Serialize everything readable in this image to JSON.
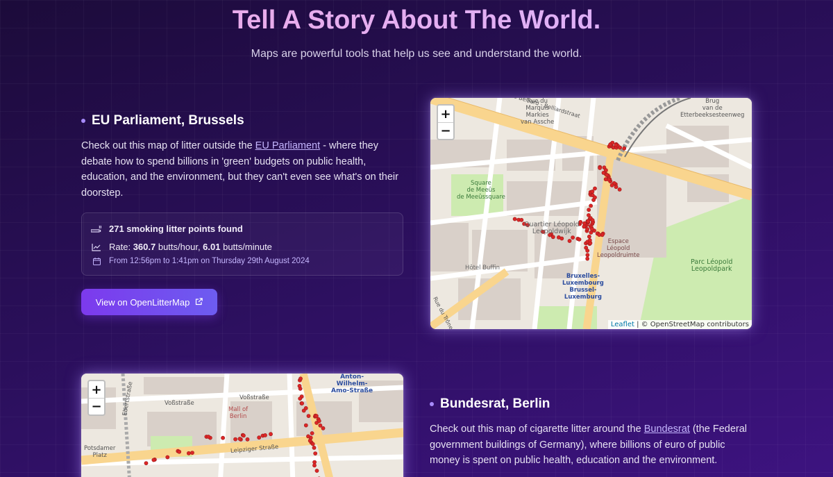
{
  "hero": {
    "title": "Tell A Story About The World.",
    "subtitle": "Maps are powerful tools that help us see and understand the world."
  },
  "sections": [
    {
      "title": "EU Parliament, Brussels",
      "paragraph_before": "Check out this map of litter outside the ",
      "link_text": "EU Parliament",
      "paragraph_after": " - where they debate how to spend billions in 'green' budgets on public health, education, and the environment, but they can't even see what's on their doorstep.",
      "stats": {
        "points": "271 smoking litter points found",
        "rate_prefix": "Rate: ",
        "rate_hour": "360.7",
        "rate_hour_unit": " butts/hour, ",
        "rate_min": "6.01",
        "rate_min_unit": " butts/minute",
        "time_range": "From 12:56pm to 1:41pm on Thursday 29th August 2024"
      },
      "button_label": "View on OpenLitterMap",
      "map": {
        "zoom_in": "+",
        "zoom_out": "−",
        "attribution_leaflet": "Leaflet",
        "attribution_rest": " | © OpenStreetMap contributors",
        "labels": {
          "rue_belliard": "Rue Belliard - Belliardstraat",
          "rue_markies": "Rue du\nMarquis\nMarkies\nvan Assche",
          "brug": "Brug\nvan de\nEtterbeeksesteenweg",
          "square_meeus": "Square\nde Meeûs\nde Meeûssquare",
          "quartier_leopold": "Quartier Léopold\nLeopoldwijk",
          "espace_leopold": "Espace\nLéopold\nLeopoldruimte",
          "parc_leopold": "Parc Léopold\nLeopoldpark",
          "hotel_buffin": "Hôtel Buffin",
          "bruxelles_lux": "Bruxelles-\nLuxembourg\nBrussel-\nLuxemburg",
          "rue_trone": "Rue du Trône - Troonstr"
        }
      }
    },
    {
      "title": "Bundesrat, Berlin",
      "paragraph_before": "Check out this map of cigarette litter around the ",
      "link_text": "Bundesrat",
      "paragraph_after": " (the Federal government buildings of Germany), where billions of euro of public money is spent on public health, education and the environment.",
      "map": {
        "zoom_in": "+",
        "zoom_out": "−",
        "labels": {
          "anton": "Anton-\nWilhelm-\nAmo-Straße",
          "voss": "Voßstraße",
          "voss2": "Voßstraße",
          "mall": "Mall of\nBerlin",
          "leipziger": "Leipziger Straße",
          "potsdamer": "Potsdamer\nPlatz",
          "ebert": "Ebertstraße"
        }
      }
    }
  ],
  "colors": {
    "accent": "#7c3aed",
    "litter_dot": "#dc2626",
    "title_gradient_start": "#f0a8e4"
  },
  "icons": [
    "smoking-icon",
    "chart-line-icon",
    "calendar-icon",
    "external-link-icon"
  ]
}
